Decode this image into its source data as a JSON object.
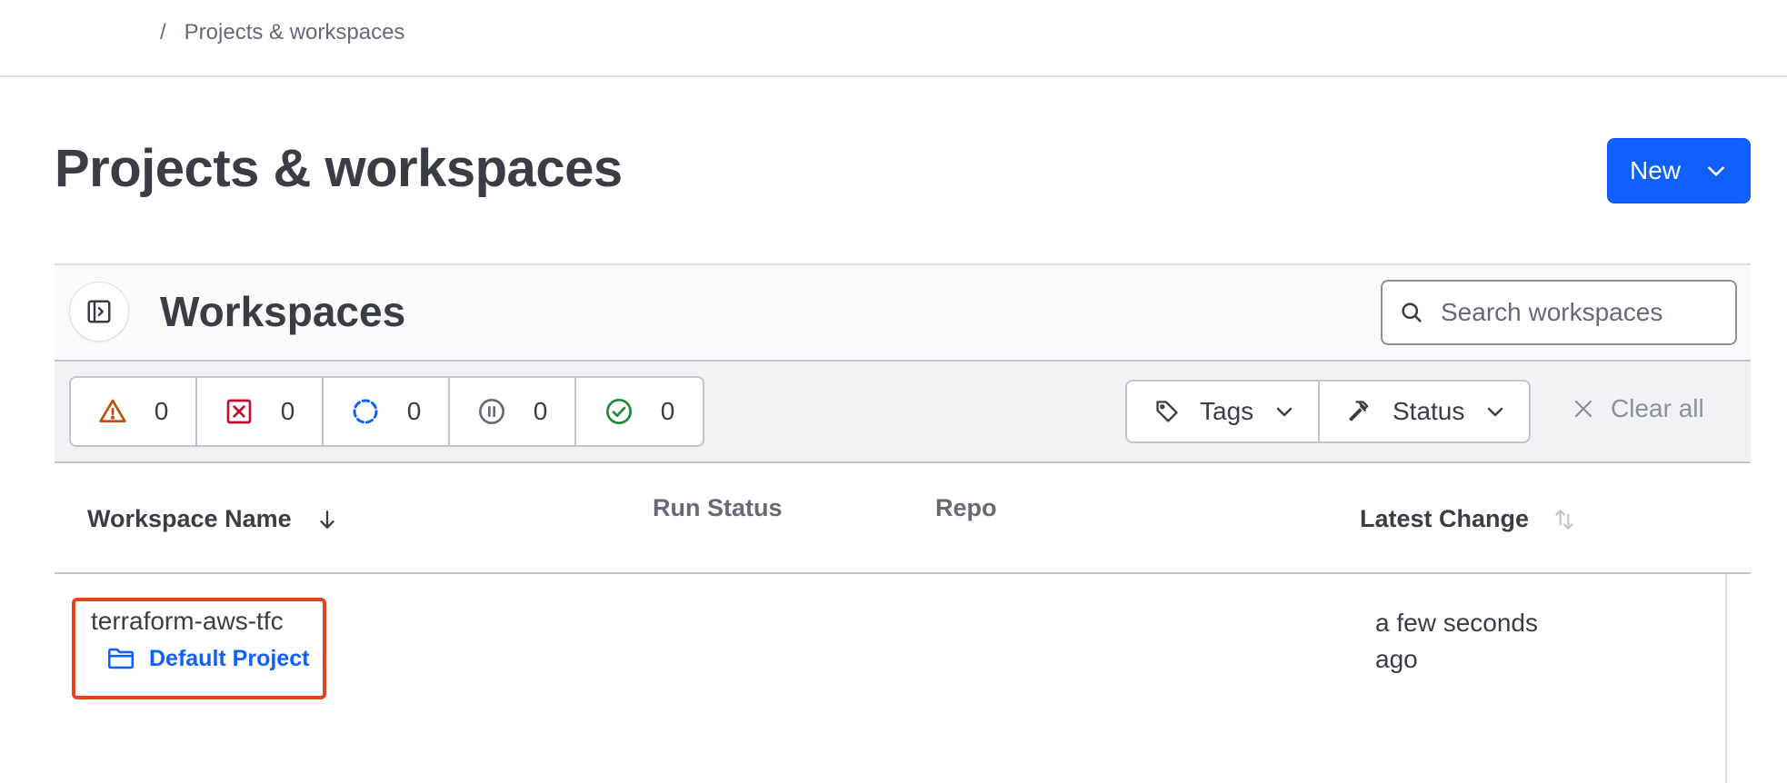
{
  "breadcrumb": {
    "separator": "/",
    "current": "Projects & workspaces"
  },
  "page": {
    "title": "Projects & workspaces",
    "new_button_label": "New"
  },
  "panel": {
    "title": "Workspaces",
    "search": {
      "placeholder": "Search workspaces",
      "value": ""
    }
  },
  "status_filters": [
    {
      "icon": "warning-icon",
      "count": "0",
      "color": "#c04c0d"
    },
    {
      "icon": "error-icon",
      "count": "0",
      "color": "#c00d29"
    },
    {
      "icon": "running-icon",
      "count": "0",
      "color": "#1060ff"
    },
    {
      "icon": "paused-icon",
      "count": "0",
      "color": "#656a76"
    },
    {
      "icon": "success-icon",
      "count": "0",
      "color": "#1a8a36"
    }
  ],
  "filters": {
    "tags_label": "Tags",
    "status_label": "Status",
    "clear_all_label": "Clear all"
  },
  "table": {
    "columns": {
      "name": "Workspace Name",
      "run_status": "Run Status",
      "repo": "Repo",
      "latest_change": "Latest Change"
    },
    "rows": [
      {
        "name": "terraform-aws-tfc",
        "project": "Default Project",
        "run_status": "",
        "repo": "",
        "latest_change": "a few seconds ago"
      }
    ]
  },
  "colors": {
    "accent": "#1060ff",
    "highlight": "#e8431f"
  }
}
